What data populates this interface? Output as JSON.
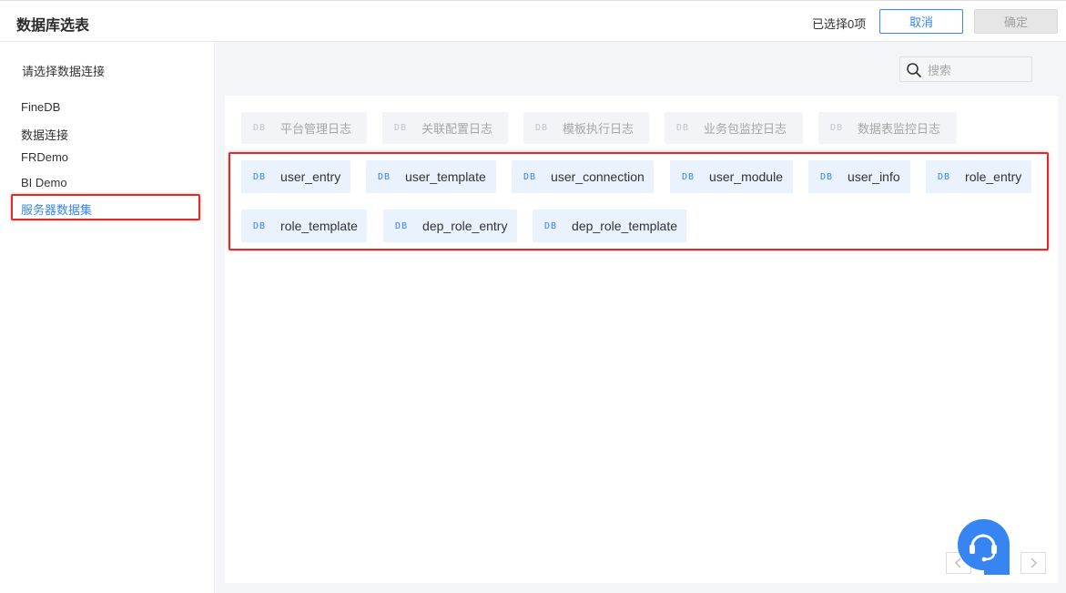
{
  "header": {
    "title": "数据库选表",
    "selected_count": "已选择0项",
    "cancel_label": "取消",
    "ok_label": "确定"
  },
  "sidebar": {
    "title": "请选择数据连接",
    "items": [
      {
        "label": "FineDB",
        "active": false
      },
      {
        "label": "数据连接",
        "active": false
      },
      {
        "label": "FRDemo",
        "active": false
      },
      {
        "label": "BI Demo",
        "active": false
      },
      {
        "label": "服务器数据集",
        "active": true
      }
    ]
  },
  "search": {
    "placeholder": "搜索",
    "value": ""
  },
  "db_icon_text": "DB",
  "disabled_tables": [
    "平台管理日志",
    "关联配置日志",
    "模板执行日志",
    "业务包监控日志",
    "数据表监控日志"
  ],
  "tables": [
    "user_entry",
    "user_template",
    "user_connection",
    "user_module",
    "user_info",
    "role_entry",
    "role_template",
    "dep_role_entry",
    "dep_role_template"
  ],
  "colors": {
    "accent": "#3685f2",
    "highlight_border": "#e02b2b",
    "chip_bg": "#e9f2fd",
    "disabled_chip_bg": "#f2f4f7"
  },
  "icons": {
    "search": "search-icon",
    "prev": "chevron-left-icon",
    "next": "chevron-right-icon",
    "support": "customer-service-icon"
  }
}
